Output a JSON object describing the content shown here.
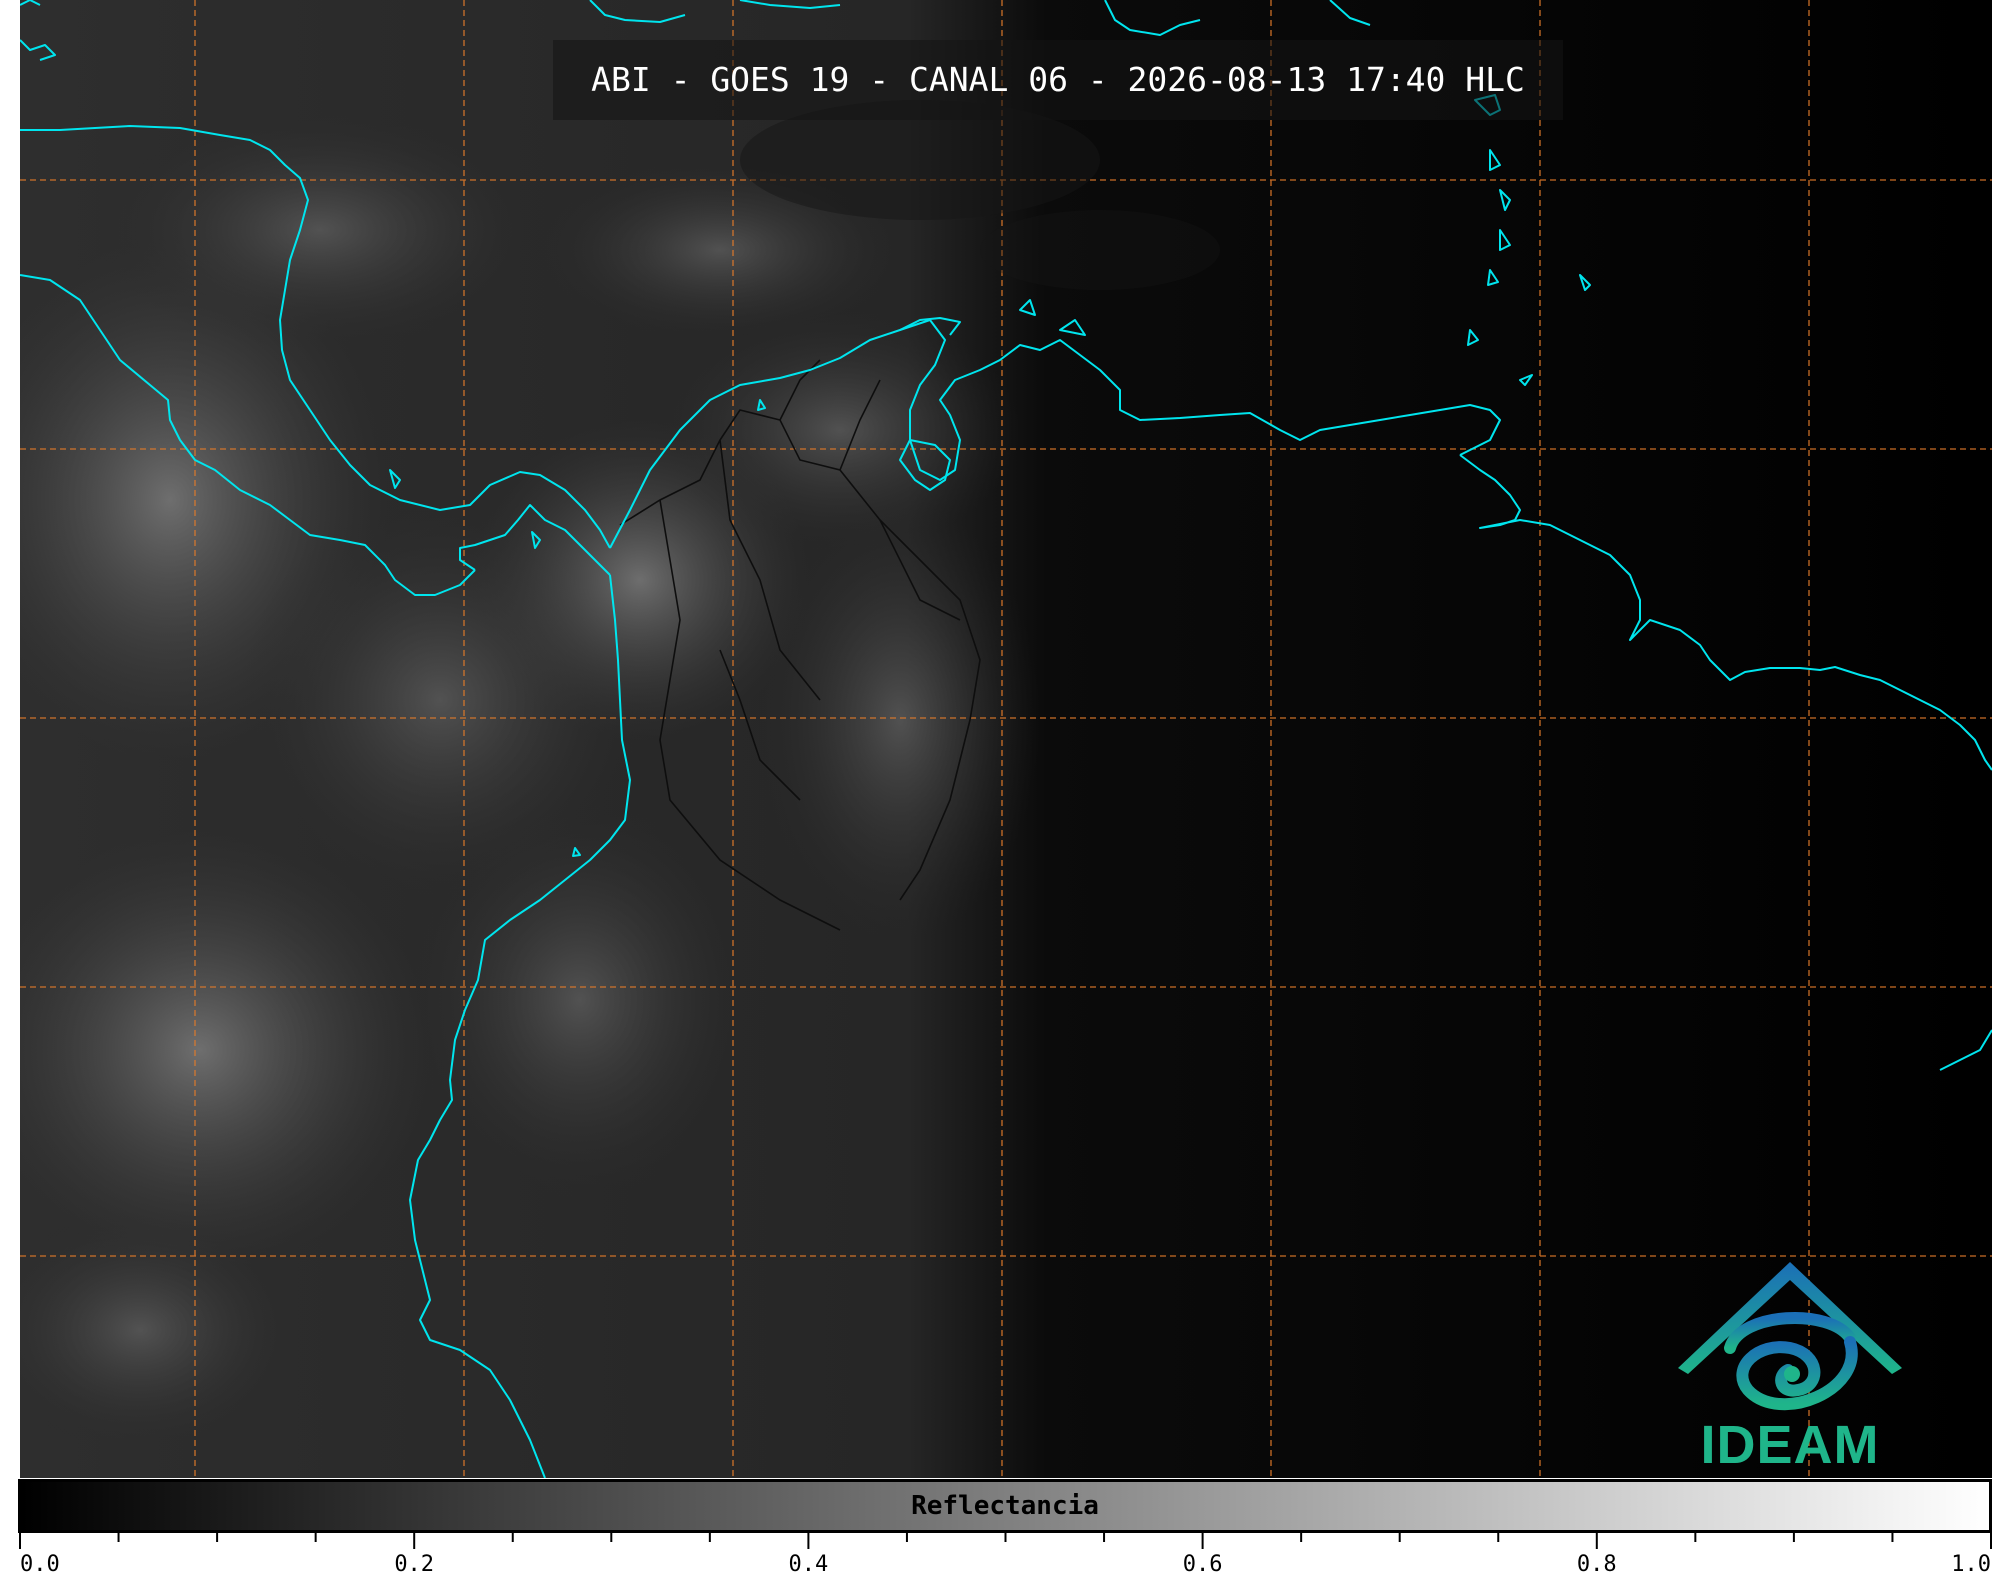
{
  "title": "ABI - GOES 19 - CANAL 06 - 2026-08-13 17:40 HLC",
  "logo": {
    "text": "IDEAM",
    "icon": "ideam-logo-icon",
    "color": "#1fb58a"
  },
  "colors": {
    "coastline": "#00e5ee",
    "grid": "#e07a2a",
    "background": "#000000",
    "borders": "#111111"
  },
  "colorbar": {
    "label": "Reflectancia",
    "colormap": "grayscale (black to white)",
    "range": [
      0.0,
      1.0
    ],
    "tick_labels": [
      "0.0",
      "0.2",
      "0.4",
      "0.6",
      "0.8",
      "1.0"
    ]
  }
}
